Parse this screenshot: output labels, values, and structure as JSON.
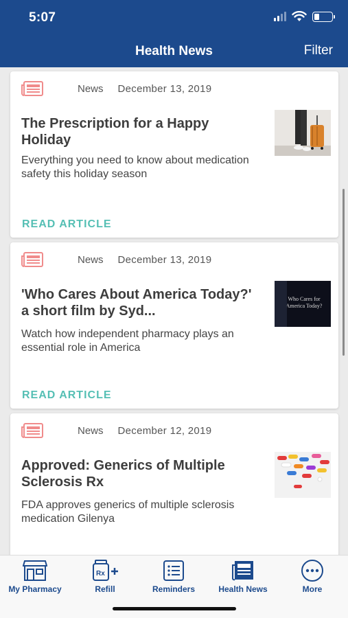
{
  "status_bar": {
    "time": "5:07"
  },
  "header": {
    "title": "Health News",
    "filter_label": "Filter"
  },
  "articles": [
    {
      "category": "News",
      "date": "December 13, 2019",
      "title": "The Prescription for a Happy Holiday",
      "description": "Everything you need to know about medication safety this holiday season",
      "link_label": "READ ARTICLE"
    },
    {
      "category": "News",
      "date": "December 13, 2019",
      "title": "'Who Cares About America Today?' a short film by Syd...",
      "description": "Watch how independent pharmacy plays an essential role in America",
      "link_label": "READ ARTICLE",
      "thumb_text": "Who Cares for America Today?"
    },
    {
      "category": "News",
      "date": "December 12, 2019",
      "title": "Approved: Generics of Multiple Sclerosis Rx",
      "description": "FDA approves generics of multiple sclerosis medication Gilenya"
    }
  ],
  "tabs": [
    {
      "label": "My Pharmacy",
      "icon": "storefront-icon"
    },
    {
      "label": "Refill",
      "icon": "rx-bottle-plus-icon"
    },
    {
      "label": "Reminders",
      "icon": "checklist-icon"
    },
    {
      "label": "Health News",
      "icon": "newspaper-icon"
    },
    {
      "label": "More",
      "icon": "more-dots-icon"
    }
  ],
  "colors": {
    "header": "#1c4a8d",
    "accent_link": "#55bfb4",
    "news_icon": "#f08b8b"
  }
}
